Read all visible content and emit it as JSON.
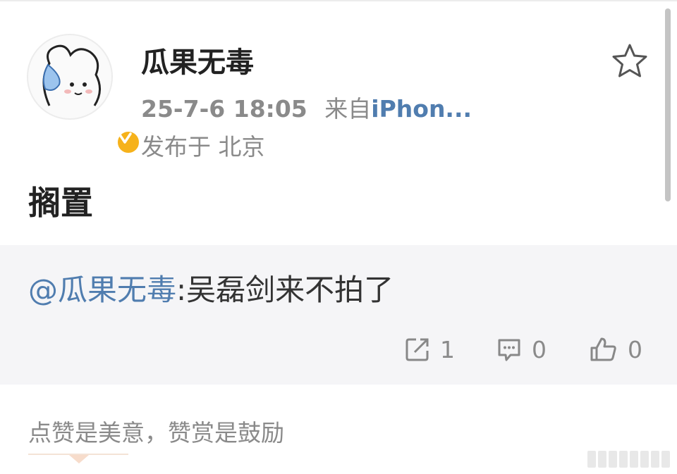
{
  "post": {
    "username": "瓜果无毒",
    "timestamp": "25-7-6 18:05",
    "source_prefix": "来自",
    "source": "iPhon...",
    "location": "发布于 北京",
    "text": "搁置"
  },
  "repost": {
    "mention": "@瓜果无毒",
    "text": ":吴磊剑来不拍了"
  },
  "actions": {
    "share_count": "1",
    "comment_count": "0",
    "like_count": "0"
  },
  "reward": {
    "slogan": "点赞是美意，赞赏是鼓励"
  },
  "colors": {
    "link": "#507daf",
    "muted": "#8a8a8a",
    "badge": "#f6b21b"
  }
}
